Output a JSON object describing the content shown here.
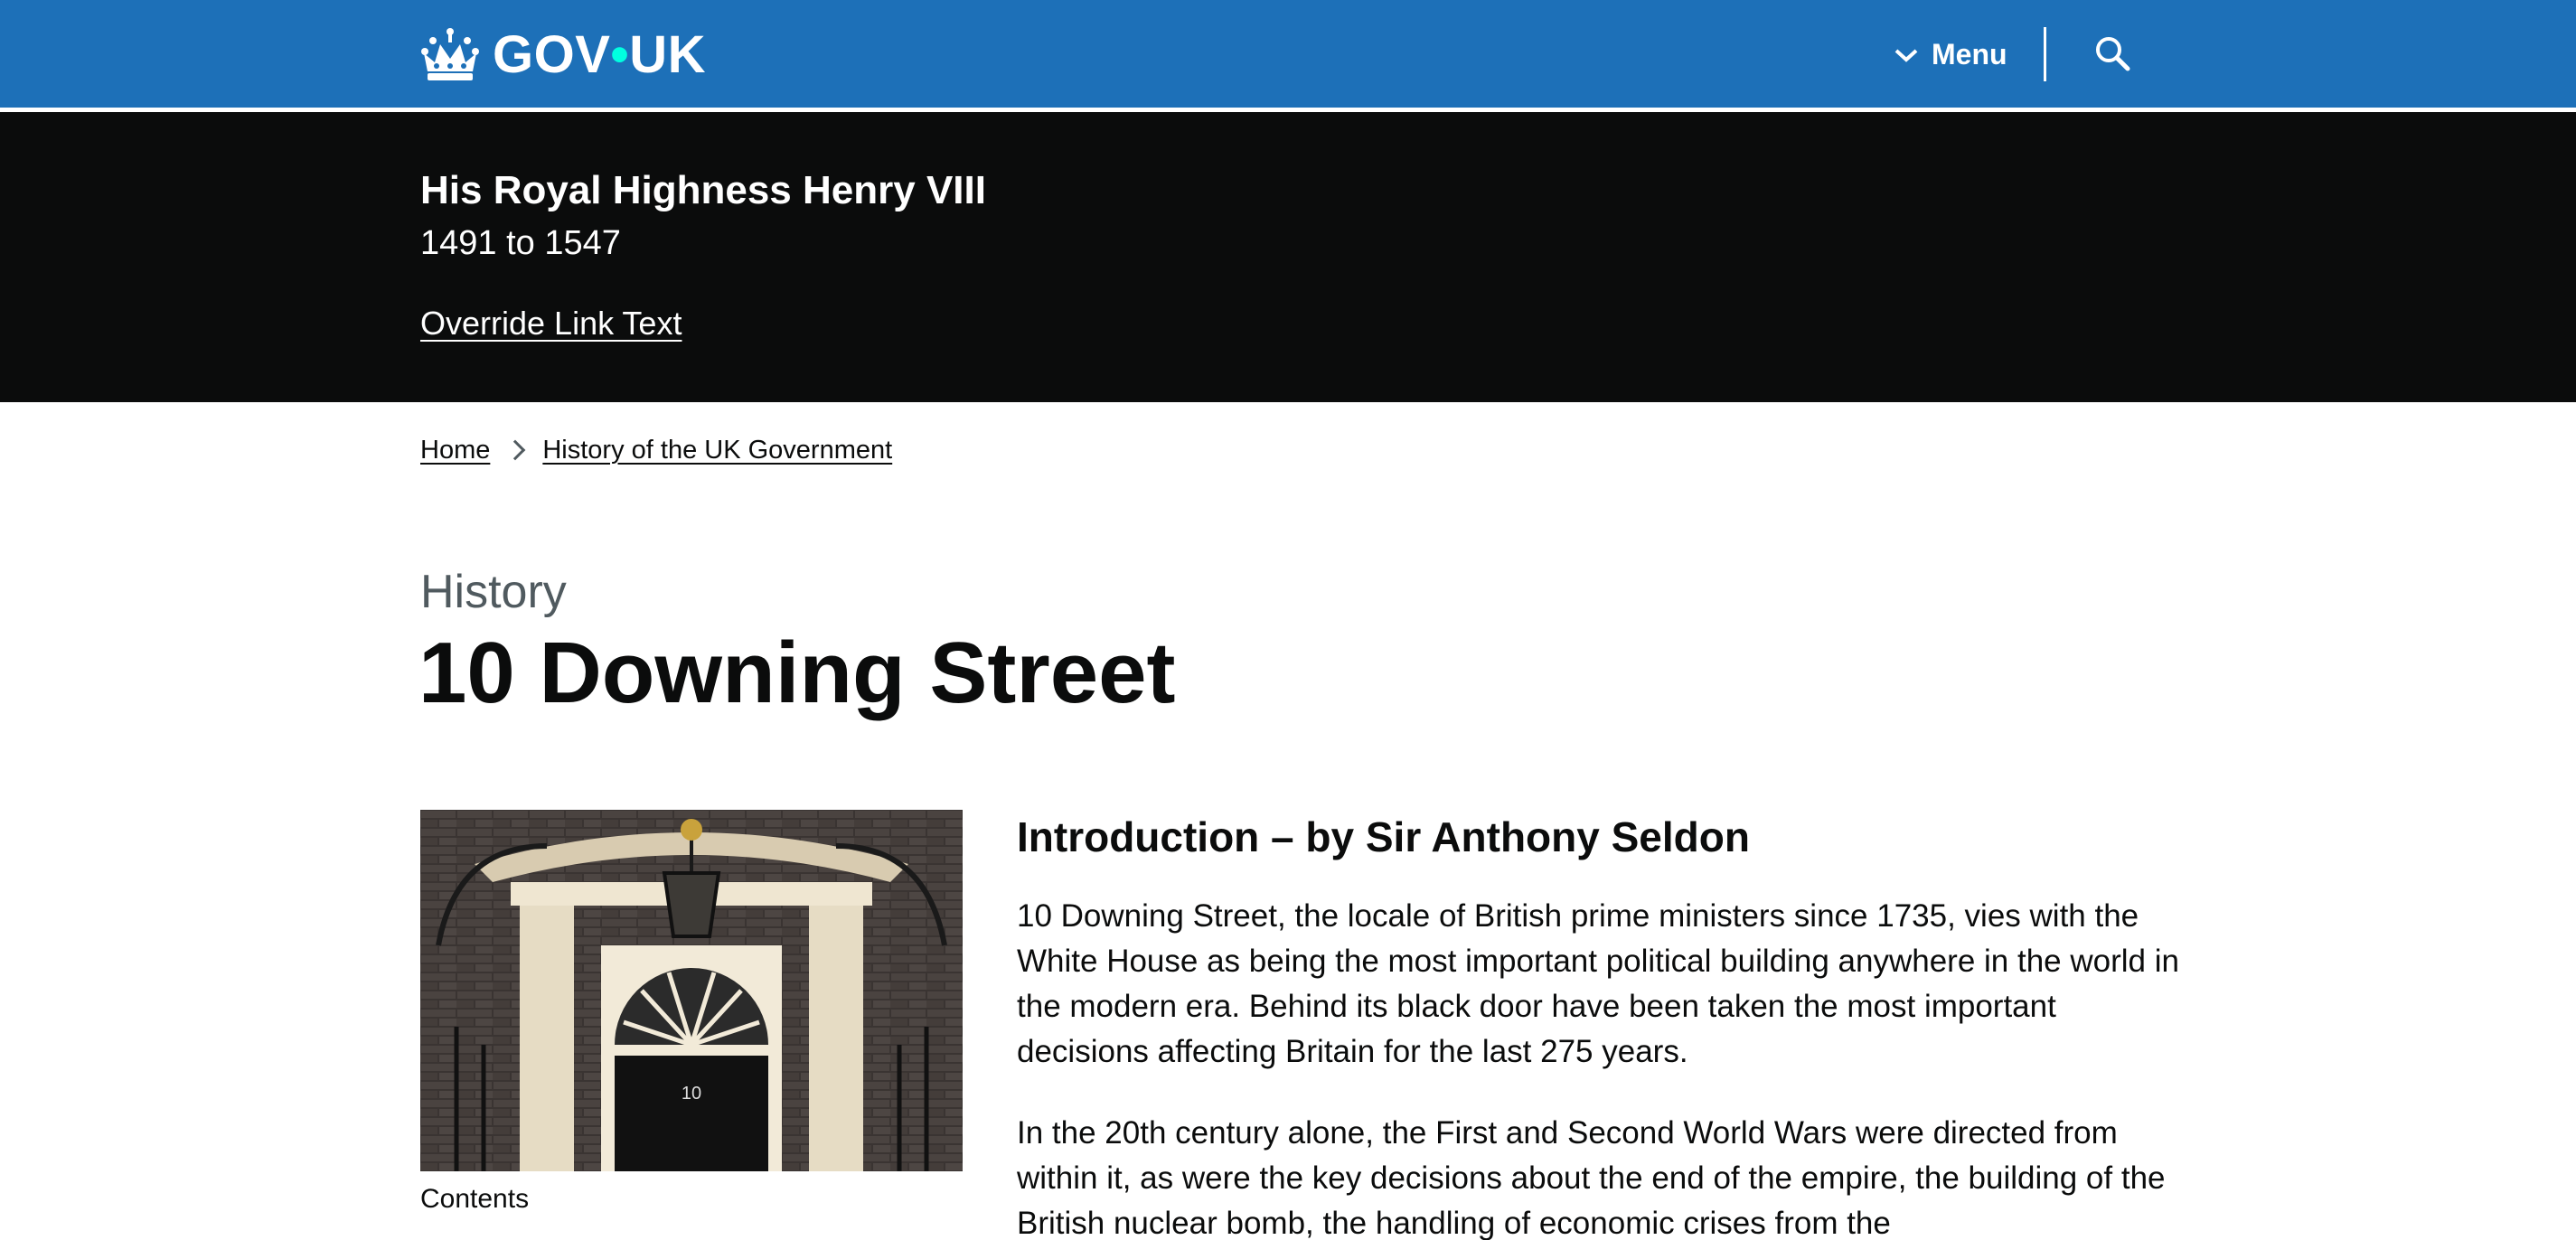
{
  "header": {
    "logo_text": "GOV",
    "logo_text_2": "UK",
    "menu_label": "Menu",
    "icons": [
      "crown-icon",
      "chevron-down-icon",
      "search-icon"
    ],
    "colors": {
      "header_bg": "#1d70b8",
      "logo_dot": "#00ffe0"
    }
  },
  "banner": {
    "title": "His Royal Highness Henry VIII",
    "dates": "1491 to 1547",
    "link_text": "Override Link Text",
    "colors": {
      "bg": "#0b0c0c"
    }
  },
  "breadcrumb": {
    "items": [
      {
        "label": "Home"
      },
      {
        "label": "History of the UK Government"
      }
    ]
  },
  "page": {
    "caption": "History",
    "title": "10 Downing Street"
  },
  "figure": {
    "door_number": "10",
    "caption": "Contents"
  },
  "article": {
    "heading": "Introduction – by Sir Anthony Seldon",
    "paragraphs": [
      "10 Downing Street, the locale of British prime ministers since 1735, vies with the White House as being the most important political building anywhere in the world in the modern era. Behind its black door have been taken the most important decisions affecting Britain for the last 275 years.",
      "In the 20th century alone, the First and Second World Wars were directed from within it, as were the key decisions about the end of the empire, the building of the British nuclear bomb, the handling of economic crises from the"
    ]
  }
}
